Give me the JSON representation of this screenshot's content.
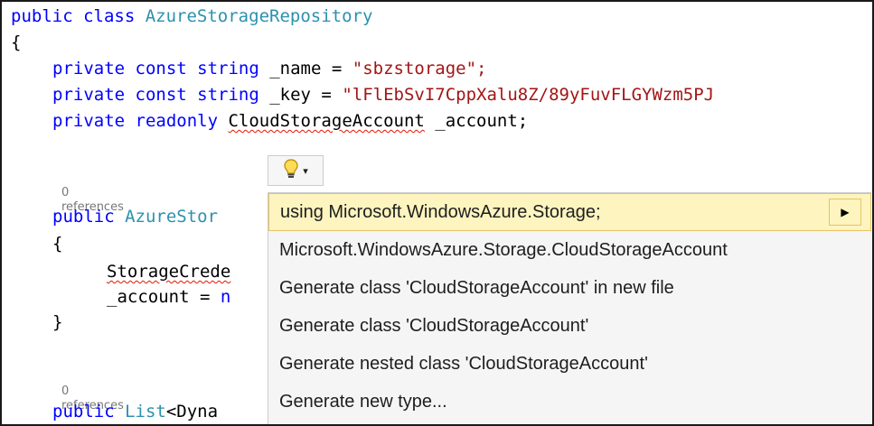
{
  "code": {
    "class_keywords": "public class",
    "class_name": "AzureStorageRepository",
    "open_brace": "{",
    "field1": {
      "modifiers": "private const string",
      "name": "_name = ",
      "value": "\"sbzstorage\";"
    },
    "field2": {
      "modifiers": "private const string",
      "name": "_key = ",
      "value": "\"lFlEbSvI7CppXalu8Z/89yFuvFLGYWzm5PJ"
    },
    "field3": {
      "modifiers": "private readonly",
      "type": "CloudStorageAccount",
      "name": "_account;"
    },
    "ctor": {
      "refs": "0 references",
      "keyword": "public",
      "name": "AzureStor"
    },
    "ctor_open": "{",
    "ctor_line1": "StorageCrede",
    "ctor_line2_a": "_account = ",
    "ctor_line2_b": "n",
    "ctor_close": "}",
    "method": {
      "refs": "0 references",
      "keyword": "public",
      "type": "List",
      "rest": "<Dyna"
    }
  },
  "lightbulb": {
    "icon": "lightbulb-icon",
    "arrow": "▾"
  },
  "quick_actions": {
    "items": [
      {
        "label": "using Microsoft.WindowsAzure.Storage;",
        "selected": true,
        "submenu_arrow": "▶"
      },
      {
        "label": "Microsoft.WindowsAzure.Storage.CloudStorageAccount"
      },
      {
        "label": "Generate class 'CloudStorageAccount' in new file"
      },
      {
        "label": "Generate class 'CloudStorageAccount'"
      },
      {
        "label": "Generate nested class 'CloudStorageAccount'"
      },
      {
        "label": "Generate new type..."
      }
    ]
  },
  "colors": {
    "keyword": "#0000ff",
    "type": "#2b91af",
    "string": "#a31515",
    "highlight": "#fdf4bf",
    "error_squiggle": "#e51400"
  }
}
